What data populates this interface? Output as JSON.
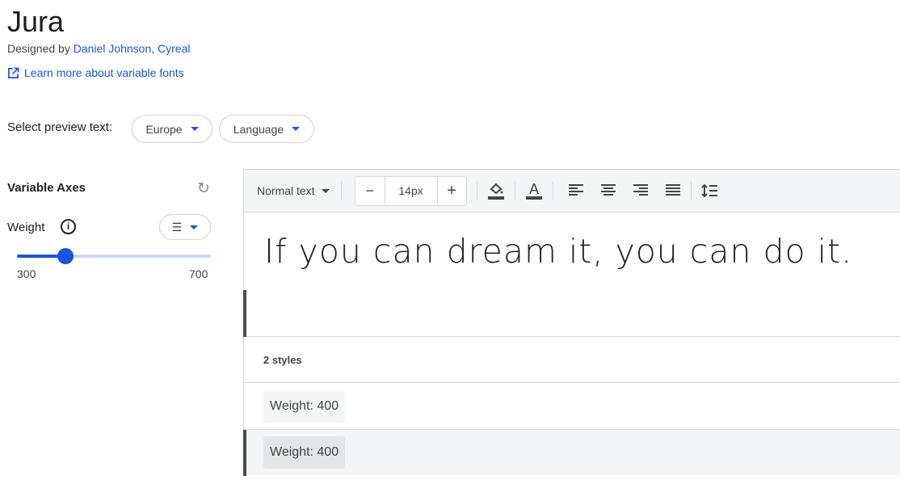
{
  "header": {
    "title": "Jura",
    "designed_by": "Designed by",
    "designers": [
      "Daniel Johnson",
      ", ",
      "Cyreal"
    ],
    "learn_more": "Learn more about variable fonts"
  },
  "preview_select": {
    "label": "Select preview text:",
    "region": "Europe",
    "language": "Language"
  },
  "axes": {
    "title": "Variable Axes",
    "weight_label": "Weight",
    "info": "i",
    "min": "300",
    "max": "700",
    "value": 400,
    "fraction": 0.25
  },
  "toolbar": {
    "style": "Normal text",
    "minus": "−",
    "size": "14px",
    "plus": "+"
  },
  "preview": {
    "text": "If you can dream it, you can do it."
  },
  "styles": {
    "count": "2 styles",
    "rows": [
      {
        "label": "Weight: 400"
      },
      {
        "label": "Weight: 400"
      }
    ]
  },
  "colors": {
    "accent": "#1a56db"
  }
}
